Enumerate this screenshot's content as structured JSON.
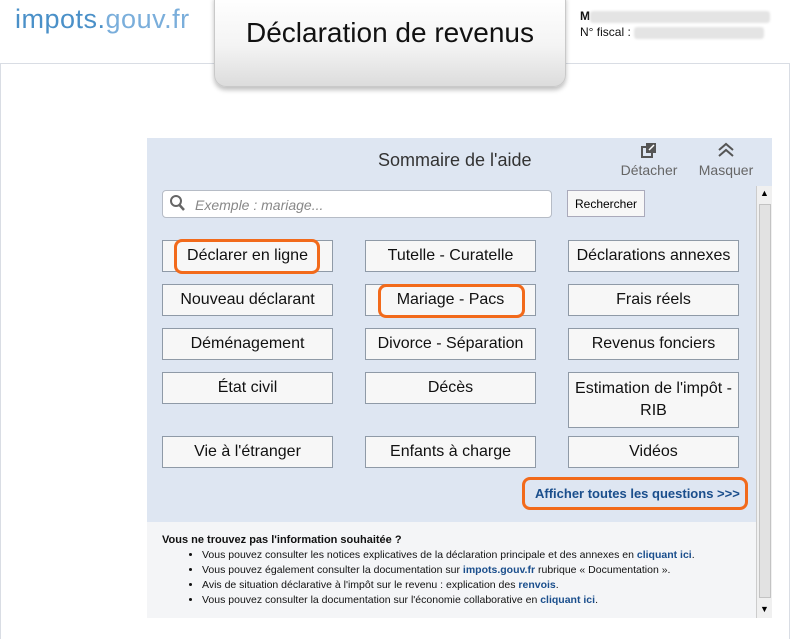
{
  "header": {
    "logo_main": "impots.",
    "logo_gouv": "gouv.fr",
    "page_title": "Déclaration de revenus",
    "user_initial": "M",
    "fiscal_label": "N° fiscal :"
  },
  "help": {
    "title": "Sommaire de l'aide",
    "detach_label": "Détacher",
    "hide_label": "Masquer",
    "search_placeholder": "Exemple : mariage...",
    "search_button": "Rechercher",
    "topics": [
      "Déclarer en ligne",
      "Tutelle - Curatelle",
      "Déclarations annexes",
      "Nouveau déclarant",
      "Mariage - Pacs",
      "Frais réels",
      "Déménagement",
      "Divorce - Séparation",
      "Revenus fonciers",
      "État civil",
      "Décès",
      "Estimation de l'impôt - RIB",
      "Vie à l'étranger",
      "Enfants à charge",
      "Vidéos"
    ],
    "all_questions": "Afficher toutes les questions >>>",
    "highlight_color": "#f26a1b"
  },
  "info": {
    "title": "Vous ne trouvez pas l'information souhaitée ?",
    "items": [
      {
        "text": "Vous pouvez consulter les notices explicatives de la déclaration principale et des annexes en ",
        "link": "cliquant ici",
        "after": "."
      },
      {
        "text": "Vous pouvez également consulter la documentation sur ",
        "link": "impots.gouv.fr",
        "after": " rubrique « Documentation »."
      },
      {
        "text": "Avis de situation déclarative à l'impôt sur le revenu : explication des ",
        "link": "renvois",
        "after": "."
      },
      {
        "text": "Vous pouvez consulter la documentation sur l'économie collaborative en ",
        "link": "cliquant ici",
        "after": "."
      }
    ]
  }
}
